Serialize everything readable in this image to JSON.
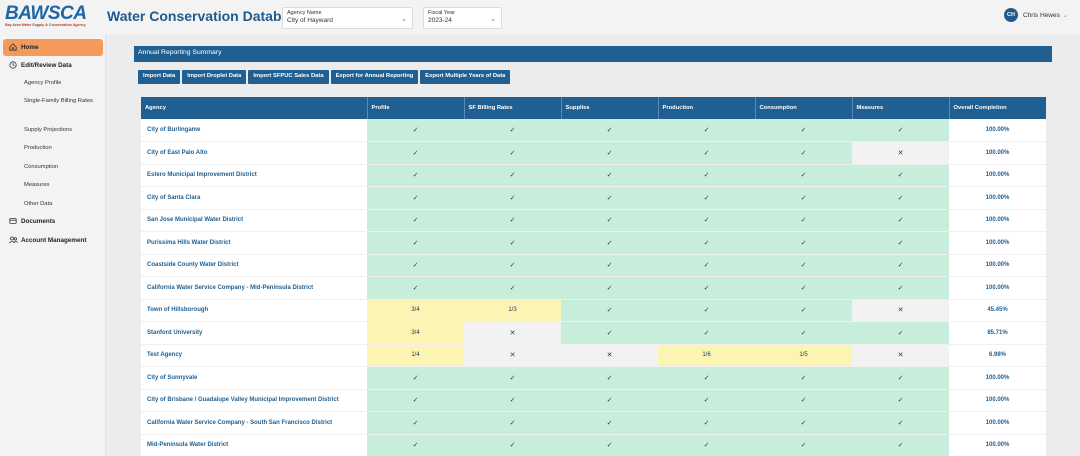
{
  "app": {
    "logo_word": "BAWSCA",
    "logo_tagline": "Bay Area Water Supply & Conservation Agency",
    "title": "Water Conservation Database"
  },
  "filters": {
    "agency": {
      "label": "Agency Name",
      "value": "City of Hayward"
    },
    "fiscal_year": {
      "label": "Fiscal Year",
      "value": "2023-24"
    }
  },
  "user": {
    "initials": "CH",
    "name": "Chris Hewes"
  },
  "sidebar": {
    "home": "Home",
    "edit_review": "Edit/Review Data",
    "sub": [
      "Agency Profile",
      "Single-Family Billing Rates",
      "Supply Projections",
      "Production",
      "Consumption",
      "Measures",
      "Other Data"
    ],
    "documents": "Documents",
    "account": "Account Management"
  },
  "main": {
    "banner": "Annual Reporting Summary",
    "actions": [
      "Import Data",
      "Import Droplet Data",
      "Import SFPUC Sales Data",
      "Export for Annual Reporting",
      "Export Multiple Years of Data"
    ]
  },
  "table": {
    "headers": [
      "Agency",
      "Profile",
      "SF Billing Rates",
      "Supplies",
      "Production",
      "Consumption",
      "Measures",
      "Overall Completion"
    ],
    "rows": [
      {
        "agency": "City of Burlingame",
        "cells": [
          "✓",
          "✓",
          "✓",
          "✓",
          "✓",
          "✓"
        ],
        "status": [
          "d",
          "d",
          "d",
          "d",
          "d",
          "d"
        ],
        "overall": "100.00%"
      },
      {
        "agency": "City of East Palo Alto",
        "cells": [
          "✓",
          "✓",
          "✓",
          "✓",
          "✓",
          "✕"
        ],
        "status": [
          "d",
          "d",
          "d",
          "d",
          "d",
          "m"
        ],
        "overall": "100.00%"
      },
      {
        "agency": "Estero Municipal Improvement District",
        "cells": [
          "✓",
          "✓",
          "✓",
          "✓",
          "✓",
          "✓"
        ],
        "status": [
          "d",
          "d",
          "d",
          "d",
          "d",
          "d"
        ],
        "overall": "100.00%"
      },
      {
        "agency": "City of Santa Clara",
        "cells": [
          "✓",
          "✓",
          "✓",
          "✓",
          "✓",
          "✓"
        ],
        "status": [
          "d",
          "d",
          "d",
          "d",
          "d",
          "d"
        ],
        "overall": "100.00%"
      },
      {
        "agency": "San Jose Municipal Water District",
        "cells": [
          "✓",
          "✓",
          "✓",
          "✓",
          "✓",
          "✓"
        ],
        "status": [
          "d",
          "d",
          "d",
          "d",
          "d",
          "d"
        ],
        "overall": "100.00%"
      },
      {
        "agency": "Purissima Hills Water District",
        "cells": [
          "✓",
          "✓",
          "✓",
          "✓",
          "✓",
          "✓"
        ],
        "status": [
          "d",
          "d",
          "d",
          "d",
          "d",
          "d"
        ],
        "overall": "100.00%"
      },
      {
        "agency": "Coastside County Water District",
        "cells": [
          "✓",
          "✓",
          "✓",
          "✓",
          "✓",
          "✓"
        ],
        "status": [
          "d",
          "d",
          "d",
          "d",
          "d",
          "d"
        ],
        "overall": "100.00%"
      },
      {
        "agency": "California Water Service Company - Mid-Peninsula District",
        "cells": [
          "✓",
          "✓",
          "✓",
          "✓",
          "✓",
          "✓"
        ],
        "status": [
          "d",
          "d",
          "d",
          "d",
          "d",
          "d"
        ],
        "overall": "100.00%"
      },
      {
        "agency": "Town of Hillsborough",
        "cells": [
          "3/4",
          "1/3",
          "✓",
          "✓",
          "✓",
          "✕"
        ],
        "status": [
          "p",
          "p",
          "d",
          "d",
          "d",
          "m"
        ],
        "overall": "45.45%"
      },
      {
        "agency": "Stanford University",
        "cells": [
          "3/4",
          "✕",
          "✓",
          "✓",
          "✓",
          "✓"
        ],
        "status": [
          "p",
          "m",
          "d",
          "d",
          "d",
          "d"
        ],
        "overall": "85.71%"
      },
      {
        "agency": "Test Agency",
        "cells": [
          "1/4",
          "✕",
          "✕",
          "1/6",
          "1/5",
          "✕"
        ],
        "status": [
          "p",
          "m",
          "m",
          "p",
          "p",
          "m"
        ],
        "overall": "6.98%"
      },
      {
        "agency": "City of Sunnyvale",
        "cells": [
          "✓",
          "✓",
          "✓",
          "✓",
          "✓",
          "✓"
        ],
        "status": [
          "d",
          "d",
          "d",
          "d",
          "d",
          "d"
        ],
        "overall": "100.00%"
      },
      {
        "agency": "City of Brisbane / Guadalupe Valley Municipal Improvement District",
        "cells": [
          "✓",
          "✓",
          "✓",
          "✓",
          "✓",
          "✓"
        ],
        "status": [
          "d",
          "d",
          "d",
          "d",
          "d",
          "d"
        ],
        "overall": "100.00%"
      },
      {
        "agency": "California Water Service Company - South San Francisco District",
        "cells": [
          "✓",
          "✓",
          "✓",
          "✓",
          "✓",
          "✓"
        ],
        "status": [
          "d",
          "d",
          "d",
          "d",
          "d",
          "d"
        ],
        "overall": "100.00%"
      },
      {
        "agency": "Mid-Peninsula Water District",
        "cells": [
          "✓",
          "✓",
          "✓",
          "✓",
          "✓",
          "✓"
        ],
        "status": [
          "d",
          "d",
          "d",
          "d",
          "d",
          "d"
        ],
        "overall": "100.00%"
      }
    ]
  },
  "colors": {
    "accent": "#1f5f91",
    "nav_active": "#f39b5a",
    "complete": "#c6eedb",
    "partial": "#fcf4b3",
    "missing": "#f2f2f2"
  },
  "icons": {
    "home": "home-icon",
    "edit": "clock-icon",
    "documents": "document-icon",
    "account": "people-icon"
  }
}
